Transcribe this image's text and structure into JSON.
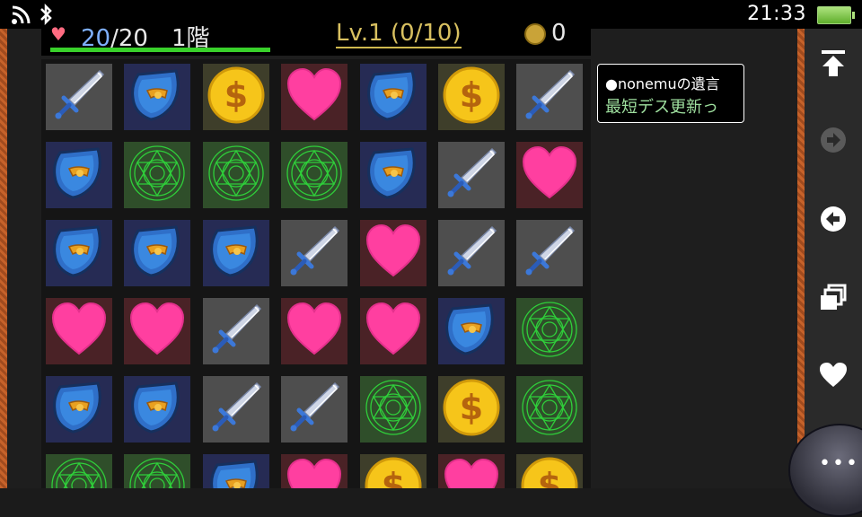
{
  "status_bar": {
    "wifi_icon": "wifi-icon",
    "bluetooth_icon": "bluetooth-icon",
    "time": "21:33",
    "battery_icon": "battery-full-icon"
  },
  "hud": {
    "hp_current": "20",
    "hp_max": "/20",
    "floor": "1階",
    "level": "Lv.1 (0/10)",
    "gold": "0",
    "hp_fraction": 1.0
  },
  "message": {
    "line1": "●nonemuの遺言",
    "line2": "最短デス更新っ"
  },
  "board": {
    "rows": [
      [
        "sword",
        "shield",
        "coin",
        "heart",
        "shield",
        "coin",
        "sword"
      ],
      [
        "shield",
        "magic",
        "magic",
        "magic",
        "shield",
        "sword",
        "heart"
      ],
      [
        "shield",
        "shield",
        "shield",
        "sword",
        "heart",
        "sword",
        "sword"
      ],
      [
        "heart",
        "heart",
        "sword",
        "heart",
        "heart",
        "shield",
        "magic"
      ],
      [
        "shield",
        "shield",
        "sword",
        "sword",
        "magic",
        "coin",
        "magic"
      ],
      [
        "magic",
        "magic",
        "shield",
        "heart",
        "coin",
        "heart",
        "coin"
      ]
    ]
  },
  "side_buttons": [
    "scroll-top-icon",
    "forward-icon",
    "back-icon",
    "windows-icon",
    "favorite-heart-icon"
  ],
  "menu_button": "more-options-icon",
  "colors": {
    "hp_bar": "#39d12b",
    "level_text": "#d8c060",
    "message_highlight": "#9fe09f",
    "border_orange": "#c6622a"
  }
}
